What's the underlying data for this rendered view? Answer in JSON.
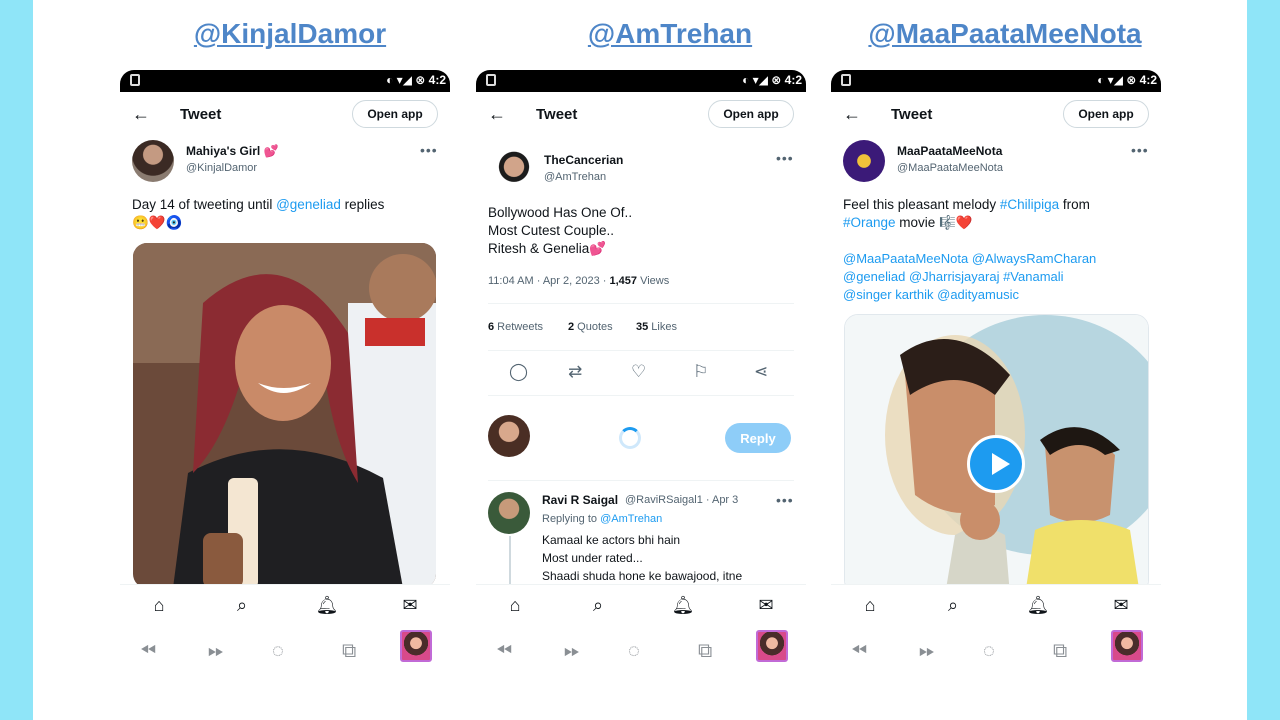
{
  "columns": [
    {
      "label": "@KinjalDamor",
      "status_time": "4:2",
      "appbar": {
        "title": "Tweet",
        "open_app": "Open app"
      },
      "author": {
        "name": "Mahiya's Girl 💕",
        "handle": "@KinjalDamor"
      },
      "text": {
        "line1_a": "Day 14 of  tweeting until ",
        "mention": "@geneliad",
        "line1_b": " replies",
        "emoji": "😬❤️🧿"
      },
      "media": "photo"
    },
    {
      "label": "@AmTrehan",
      "status_time": "4:2",
      "appbar": {
        "title": "Tweet",
        "open_app": "Open app"
      },
      "author": {
        "name": "TheCancerian",
        "handle": "@AmTrehan"
      },
      "text": {
        "line1": "Bollywood Has One Of..",
        "line2": "Most Cutest Couple..",
        "line3": "Ritesh & Genelia💕"
      },
      "meta": {
        "time": "11:04 AM · Apr 2, 2023 · ",
        "views_count": "1,457",
        "views_label": " Views"
      },
      "stats": {
        "retweets_count": "6",
        "retweets_label": " Retweets",
        "quotes_count": "2",
        "quotes_label": " Quotes",
        "likes_count": "35",
        "likes_label": " Likes"
      },
      "reply_button": "Reply",
      "reply": {
        "name": "Ravi R Saigal",
        "handle": "@RaviRSaigal1 · Apr 3",
        "replying_label": "Replying to ",
        "replying_handle": "@AmTrehan",
        "line1": "Kamaal ke actors bhi hain",
        "line2": "Most under rated...",
        "line3": "Shaadi shuda hone ke bawajood, itne"
      }
    },
    {
      "label": "@MaaPaataMeeNota",
      "status_time": "4:2",
      "appbar": {
        "title": "Tweet",
        "open_app": "Open app"
      },
      "author": {
        "name": "MaaPaataMeeNota",
        "handle": "@MaaPaataMeeNota"
      },
      "text": {
        "a": "Feel this pleasant melody ",
        "tag1": "#Chilipiga",
        "b": " from",
        "tag2": "#Orange",
        "c": " movie 🎼❤️",
        "m1": "@MaaPaataMeeNota @AlwaysRamCharan",
        "m2": "@geneliad  @Jharrisjayaraj  #Vanamali",
        "m3": "@singer karthik  @adityamusic"
      },
      "media": "video"
    }
  ],
  "icons": {
    "nav": [
      "home-icon",
      "search-icon",
      "bell-icon",
      "mail-icon"
    ],
    "browser": [
      "back-icon",
      "forward-icon",
      "loading-icon",
      "tabs-icon",
      "profile-thumb"
    ]
  },
  "colors": {
    "page_bg": "#8fe5f8",
    "link": "#1d9bf0",
    "title": "#4e86c8"
  }
}
